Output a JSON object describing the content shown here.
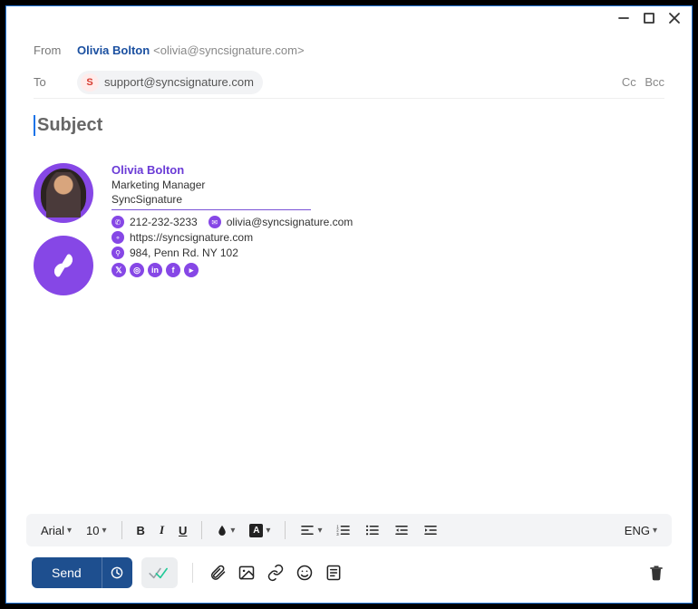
{
  "header": {
    "from_label": "From",
    "from_name": "Olivia Bolton",
    "from_email": "<olivia@syncsignature.com>",
    "to_label": "To",
    "to_chip_badge": "S",
    "to_chip_email": "support@syncsignature.com",
    "cc": "Cc",
    "bcc": "Bcc"
  },
  "subject": {
    "placeholder": "Subject"
  },
  "signature": {
    "name": "Olivia Bolton",
    "title": "Marketing Manager",
    "company": "SyncSignature",
    "phone": "212-232-3233",
    "email": "olivia@syncsignature.com",
    "website": "https://syncsignature.com",
    "address": "984, Penn Rd. NY 102",
    "socials": [
      "x",
      "instagram",
      "linkedin",
      "facebook",
      "youtube"
    ]
  },
  "toolbar": {
    "font": "Arial",
    "size": "10",
    "lang": "ENG"
  },
  "actions": {
    "send": "Send"
  }
}
